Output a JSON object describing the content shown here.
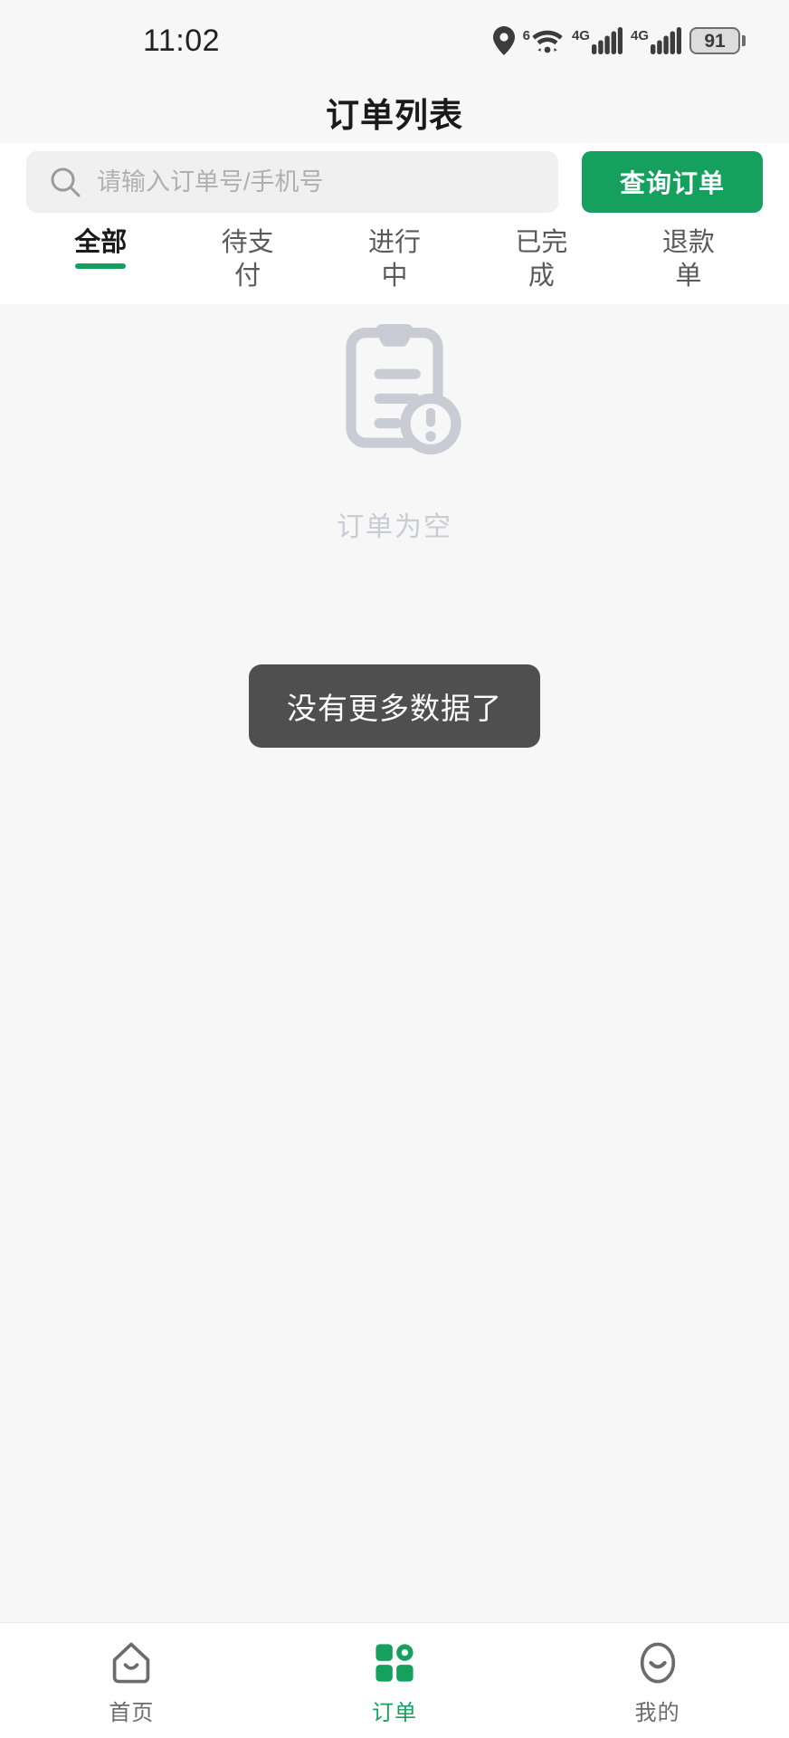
{
  "status_bar": {
    "time": "11:02",
    "location_icon": "location-pin-icon",
    "wifi_generation": "6",
    "wifi_plus": "+",
    "wifi_icon": "wifi-icon",
    "sim1_network": "4G",
    "sim1_icon": "signal-bars-icon",
    "sim2_network": "4G",
    "sim2_icon": "signal-bars-icon",
    "battery_level": "91",
    "battery_icon": "battery-icon"
  },
  "header": {
    "title": "订单列表"
  },
  "search": {
    "icon": "search-icon",
    "value": "",
    "placeholder": "请输入订单号/手机号",
    "button_label": "查询订单"
  },
  "tabs": {
    "active_index": 0,
    "items": [
      {
        "label": "全部"
      },
      {
        "label": "待支付"
      },
      {
        "label": "进行中"
      },
      {
        "label": "已完成"
      },
      {
        "label": "退款单"
      }
    ]
  },
  "content": {
    "empty_icon": "clipboard-alert-icon",
    "empty_text": "订单为空",
    "toast_text": "没有更多数据了"
  },
  "bottom_nav": {
    "active_index": 1,
    "items": [
      {
        "label": "首页",
        "icon": "home-icon"
      },
      {
        "label": "订单",
        "icon": "grid-orders-icon"
      },
      {
        "label": "我的",
        "icon": "profile-smile-icon"
      }
    ]
  },
  "colors": {
    "accent": "#15a05e",
    "page_bg": "#f7f7f7",
    "toast_bg": "#4f4f4f",
    "empty_gray": "#c9ccd4"
  }
}
